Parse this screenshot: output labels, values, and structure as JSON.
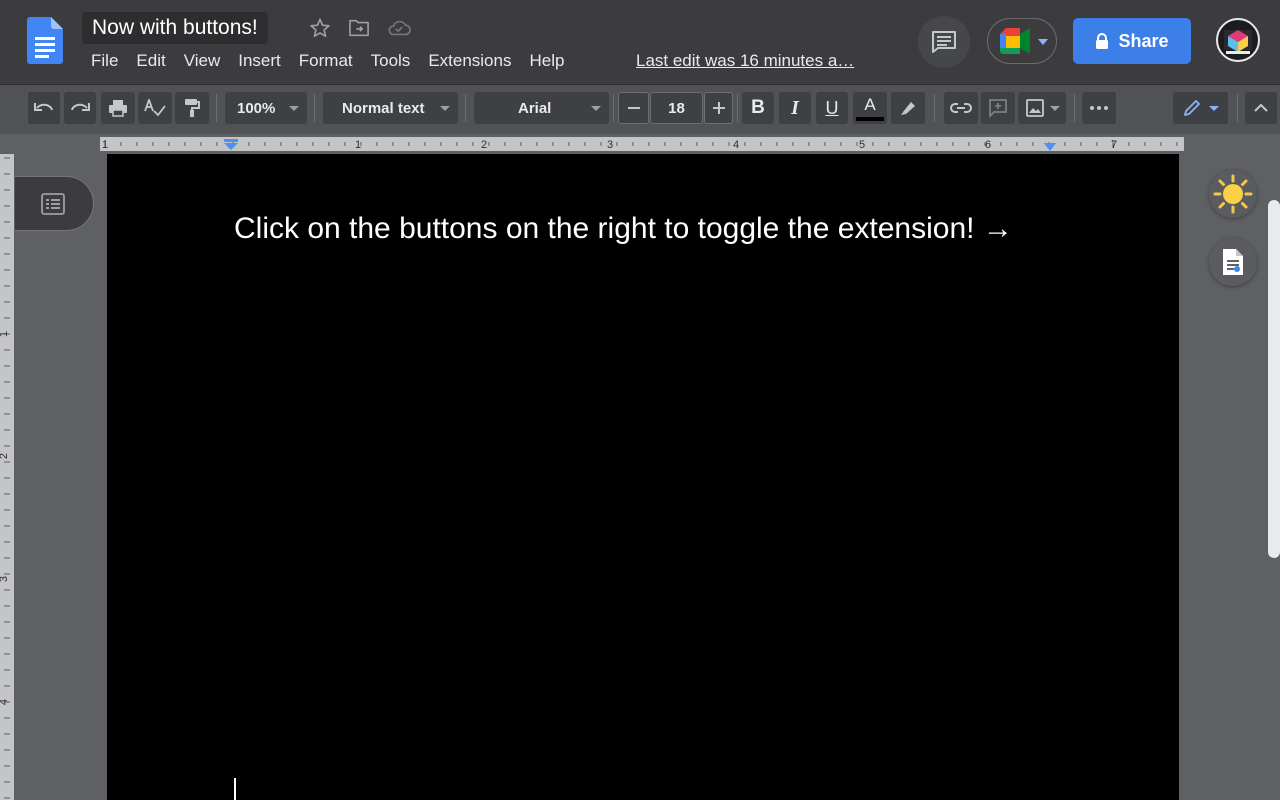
{
  "header": {
    "doc_title": "Now with buttons!",
    "menu": [
      "File",
      "Edit",
      "View",
      "Insert",
      "Format",
      "Tools",
      "Extensions",
      "Help"
    ],
    "last_edit": "Last edit was 16 minutes a…",
    "share_label": "Share"
  },
  "toolbar": {
    "zoom": "100%",
    "style": "Normal text",
    "font": "Arial",
    "font_size": "18"
  },
  "ruler": {
    "horizontal_labels": [
      "1",
      "1",
      "2",
      "3",
      "4",
      "5",
      "6",
      "7"
    ],
    "vertical_labels": [
      "1",
      "2",
      "3",
      "4"
    ]
  },
  "document": {
    "text": "Click on the buttons on the right to toggle the extension! →"
  },
  "colors": {
    "header_bg": "#3c3c3f",
    "toolbar_bg": "#515255",
    "share_blue": "#3d7fe8",
    "page_bg": "#000000",
    "text_color": "#ffffff"
  }
}
